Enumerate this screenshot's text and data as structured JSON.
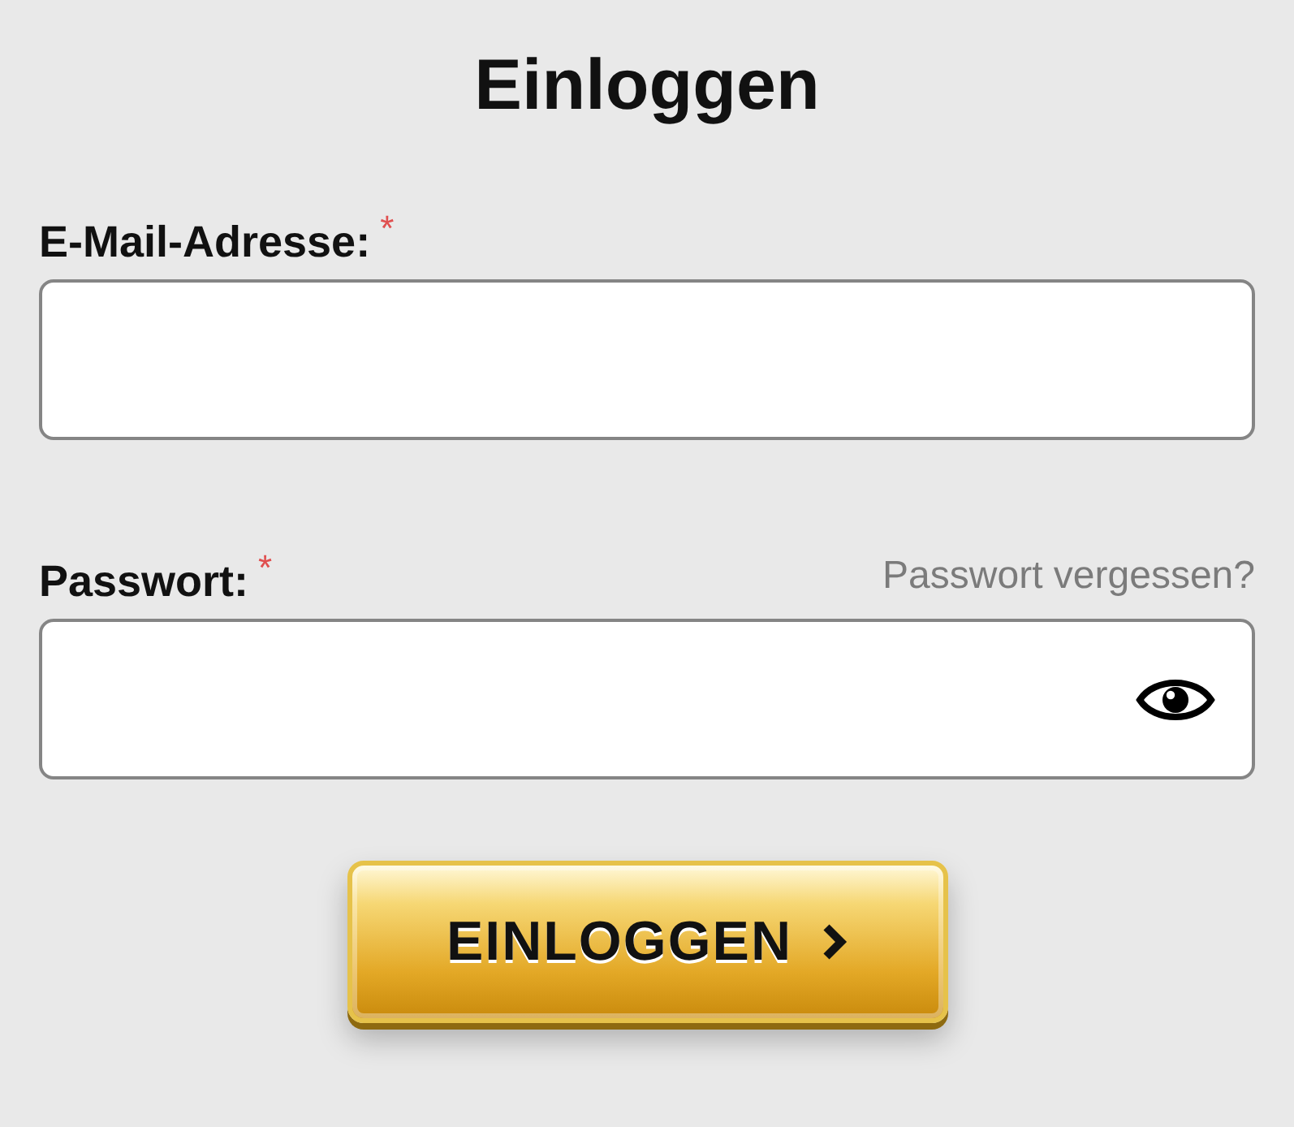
{
  "title": "Einloggen",
  "fields": [
    {
      "kind": "email",
      "label": "E-Mail-Adresse:",
      "required_mark": "*"
    },
    {
      "kind": "password",
      "label": "Passwort:",
      "required_mark": "*",
      "link": "Passwort vergessen?"
    }
  ],
  "submit": {
    "label": "EINLOGGEN"
  }
}
